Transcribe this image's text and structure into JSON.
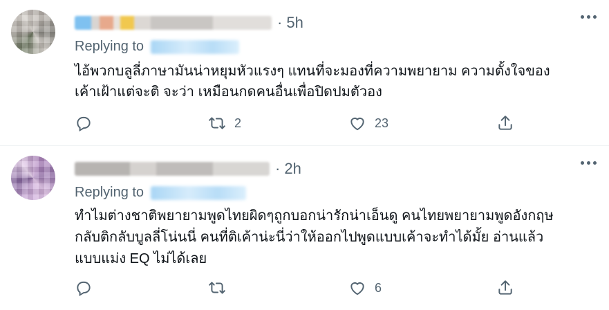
{
  "tweets": [
    {
      "time": "5h",
      "replying_label": "Replying to",
      "lines": [
        "ไอ้พวกบลูลี่ภาษามันน่าหยุมหัวแรงๆ แทนที่จะมองที่ความพยายาม ความตั้งใจของ",
        "เค้าเฝ้าแต่จะติ จะว่า เหมือนกดคนอื่นเพื่อปิดปมตัวอง"
      ],
      "reply_count": "",
      "retweet_count": "2",
      "like_count": "23"
    },
    {
      "time": "2h",
      "replying_label": "Replying to",
      "lines": [
        "ทำไมต่างชาติพยายามพูดไทยผิดๆถูกบอกน่ารักน่าเอ็นดู คนไทยพยายามพูดอังกฤษ",
        "กลับติกลับบูลลี่โน่นนี่ คนที่ติเค้าน่ะนี่ว่าให้ออกไปพูดแบบเค้าจะทำได้มั้ย อ่านแล้ว",
        "แบบแม่ง EQ ไม่ได้เลย"
      ],
      "reply_count": "",
      "retweet_count": "",
      "like_count": "6"
    }
  ],
  "separator": "·",
  "icons": [
    "reply-icon",
    "retweet-icon",
    "like-icon",
    "share-icon",
    "more-icon"
  ],
  "colors": {
    "secondary_text": "#536471",
    "primary_text": "#0f1419",
    "divider": "#eff3f4"
  }
}
